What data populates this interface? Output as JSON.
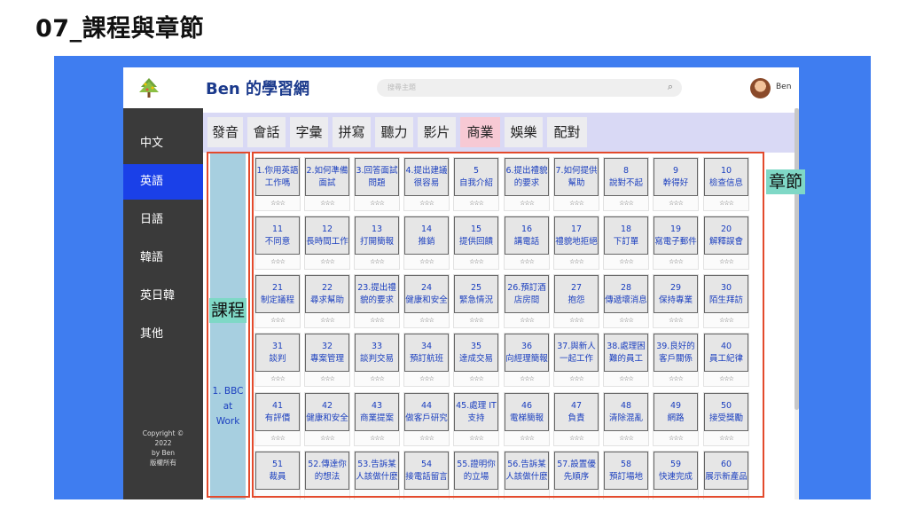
{
  "slide": {
    "title": "07_課程與章節"
  },
  "header": {
    "brand": "Ben 的學習網",
    "search_placeholder": "搜尋主題",
    "user_name": "Ben"
  },
  "sidebar": {
    "items": [
      {
        "label": "中文",
        "active": false
      },
      {
        "label": "英語",
        "active": true
      },
      {
        "label": "日語",
        "active": false
      },
      {
        "label": "韓語",
        "active": false
      },
      {
        "label": "英日韓",
        "active": false
      },
      {
        "label": "其他",
        "active": false
      }
    ],
    "copyright": [
      "Copyright ©",
      "2022",
      "by Ben",
      "版權所有"
    ]
  },
  "tabs": [
    {
      "label": "發音",
      "active": false
    },
    {
      "label": "會話",
      "active": false
    },
    {
      "label": "字彙",
      "active": false
    },
    {
      "label": "拼寫",
      "active": false
    },
    {
      "label": "聽力",
      "active": false
    },
    {
      "label": "影片",
      "active": false
    },
    {
      "label": "商業",
      "active": true
    },
    {
      "label": "娛樂",
      "active": false
    },
    {
      "label": "配對",
      "active": false
    }
  ],
  "course": {
    "label": "1. BBC at Work"
  },
  "chapters": [
    {
      "num": "1.",
      "title": "你用英語工作嗎",
      "rating": "☆☆☆"
    },
    {
      "num": "2.",
      "title": "如何準備面試",
      "rating": "☆☆☆"
    },
    {
      "num": "3.",
      "title": "回答面試問題",
      "rating": "☆☆☆"
    },
    {
      "num": "4.",
      "title": "提出建議很容易",
      "rating": "☆☆☆"
    },
    {
      "num": "5",
      "title": "自我介紹",
      "rating": "☆☆☆"
    },
    {
      "num": "6.",
      "title": "提出禮貌的要求",
      "rating": "☆☆☆"
    },
    {
      "num": "7.",
      "title": "如何提供幫助",
      "rating": "☆☆☆"
    },
    {
      "num": "8",
      "title": "說對不起",
      "rating": "☆☆☆"
    },
    {
      "num": "9",
      "title": "幹得好",
      "rating": "☆☆☆"
    },
    {
      "num": "10",
      "title": "檢查信息",
      "rating": "☆☆☆"
    },
    {
      "num": "11",
      "title": "不同意",
      "rating": "☆☆☆"
    },
    {
      "num": "12",
      "title": "長時間工作",
      "rating": "☆☆☆"
    },
    {
      "num": "13",
      "title": "打開簡報",
      "rating": "☆☆☆"
    },
    {
      "num": "14",
      "title": "推銷",
      "rating": "☆☆☆"
    },
    {
      "num": "15",
      "title": "提供回饋",
      "rating": "☆☆☆"
    },
    {
      "num": "16",
      "title": "講電話",
      "rating": "☆☆☆"
    },
    {
      "num": "17",
      "title": "禮貌地拒絕",
      "rating": "☆☆☆"
    },
    {
      "num": "18",
      "title": "下訂單",
      "rating": "☆☆☆"
    },
    {
      "num": "19",
      "title": "寫電子郵件",
      "rating": "☆☆☆"
    },
    {
      "num": "20",
      "title": "解釋誤會",
      "rating": "☆☆☆"
    },
    {
      "num": "21",
      "title": "制定議程",
      "rating": "☆☆☆"
    },
    {
      "num": "22",
      "title": "尋求幫助",
      "rating": "☆☆☆"
    },
    {
      "num": "23.",
      "title": "提出禮貌的要求",
      "rating": "☆☆☆"
    },
    {
      "num": "24",
      "title": "健康和安全",
      "rating": "☆☆☆"
    },
    {
      "num": "25",
      "title": "緊急情況",
      "rating": "☆☆☆"
    },
    {
      "num": "26.",
      "title": "預訂酒店房間",
      "rating": "☆☆☆"
    },
    {
      "num": "27",
      "title": "抱怨",
      "rating": "☆☆☆"
    },
    {
      "num": "28",
      "title": "傳遞壞消息",
      "rating": "☆☆☆"
    },
    {
      "num": "29",
      "title": "保持專業",
      "rating": "☆☆☆"
    },
    {
      "num": "30",
      "title": "陌生拜訪",
      "rating": "☆☆☆"
    },
    {
      "num": "31",
      "title": "談判",
      "rating": "☆☆☆"
    },
    {
      "num": "32",
      "title": "專案管理",
      "rating": "☆☆☆"
    },
    {
      "num": "33",
      "title": "談判交易",
      "rating": "☆☆☆"
    },
    {
      "num": "34",
      "title": "預訂航班",
      "rating": "☆☆☆"
    },
    {
      "num": "35",
      "title": "達成交易",
      "rating": "☆☆☆"
    },
    {
      "num": "36",
      "title": "向經理簡報",
      "rating": "☆☆☆"
    },
    {
      "num": "37.",
      "title": "與新人一起工作",
      "rating": "☆☆☆"
    },
    {
      "num": "38.",
      "title": "處理困難的員工",
      "rating": "☆☆☆"
    },
    {
      "num": "39.",
      "title": "良好的客戶關係",
      "rating": "☆☆☆"
    },
    {
      "num": "40",
      "title": "員工紀律",
      "rating": "☆☆☆"
    },
    {
      "num": "41",
      "title": "有評價",
      "rating": "☆☆☆"
    },
    {
      "num": "42",
      "title": "健康和安全",
      "rating": "☆☆☆"
    },
    {
      "num": "43",
      "title": "商業提案",
      "rating": "☆☆☆"
    },
    {
      "num": "44",
      "title": "做客戶研究",
      "rating": "☆☆☆"
    },
    {
      "num": "45.",
      "title": "處理 IT 支持",
      "rating": "☆☆☆"
    },
    {
      "num": "46",
      "title": "電梯簡報",
      "rating": "☆☆☆"
    },
    {
      "num": "47",
      "title": "負責",
      "rating": "☆☆☆"
    },
    {
      "num": "48",
      "title": "清除混亂",
      "rating": "☆☆☆"
    },
    {
      "num": "49",
      "title": "網路",
      "rating": "☆☆☆"
    },
    {
      "num": "50",
      "title": "接受獎勵",
      "rating": "☆☆☆"
    },
    {
      "num": "51",
      "title": "裁員",
      "rating": ""
    },
    {
      "num": "52.",
      "title": "傳達你的想法",
      "rating": ""
    },
    {
      "num": "53.",
      "title": "告訴某人該做什麼",
      "rating": ""
    },
    {
      "num": "54",
      "title": "接電話留言",
      "rating": ""
    },
    {
      "num": "55.",
      "title": "證明你的立場",
      "rating": ""
    },
    {
      "num": "56.",
      "title": "告訴某人該做什麼",
      "rating": ""
    },
    {
      "num": "57.",
      "title": "設置優先順序",
      "rating": ""
    },
    {
      "num": "58",
      "title": "預訂場地",
      "rating": ""
    },
    {
      "num": "59",
      "title": "快速完成",
      "rating": ""
    },
    {
      "num": "60",
      "title": "展示新產品",
      "rating": ""
    }
  ],
  "annotations": {
    "course_label": "課程",
    "chapter_label": "章節"
  }
}
